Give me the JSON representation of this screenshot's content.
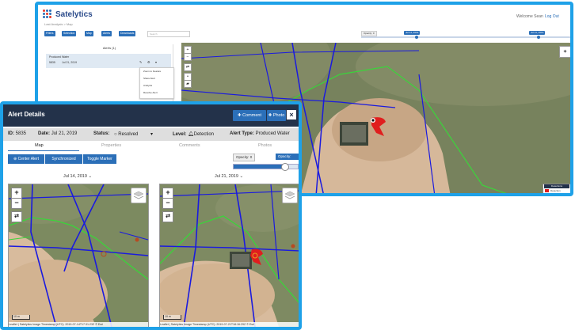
{
  "app": {
    "name": "Satelytics",
    "welcome": "Welcome Sean",
    "logout": "Log Out",
    "breadcrumb": "Last Analysis  >  Map"
  },
  "toolbar": {
    "buttons": [
      "Filters",
      "Selection",
      "Map",
      "Alerts",
      "Downloads"
    ],
    "search_placeholder": "Search",
    "opacity_label": "Opacity: 0",
    "date_a": "Jul 14, 2019",
    "date_b": "Jul 21, 2019"
  },
  "alerts_panel": {
    "title": "Alerts (1)",
    "alert_type": "Produced Water",
    "alert_id": "5835",
    "alert_date": "Jul 21, 2019",
    "menu": [
      "Zoom to Feature",
      "Share Alert",
      "Analysis",
      "Resolve Alert"
    ]
  },
  "legend": {
    "title": "Detections",
    "item": "Detection",
    "color": "#e01e1e"
  },
  "dialog": {
    "title": "Alert Details",
    "comment_button": "Comment",
    "photo_button": "Photo",
    "close": "×",
    "info": {
      "id_label": "ID:",
      "id": "5835",
      "date_label": "Date:",
      "date": "Jul 21, 2019",
      "status_label": "Status:",
      "status": "Resolved",
      "level_label": "Level:",
      "level": "Detection",
      "type_label": "Alert Type:",
      "type": "Produced Water"
    },
    "tabs": [
      "Map",
      "Properties",
      "Comments",
      "Photos"
    ],
    "map_buttons": [
      "Center Alert",
      "Synchronized",
      "Toggle Marker"
    ],
    "opacity_left": "Opacity: 0",
    "opacity_right": "Opacity: 0.4",
    "opacity_value": 0.8,
    "left_map": {
      "date": "Jul 14, 2019",
      "scale": "10 m",
      "attribution": "Leaflet | Satelytics Image Timestamp (UTC): 2019-07-14T17:31:23Z  © Esri"
    },
    "right_map": {
      "date": "Jul 21, 2019",
      "scale": "10 m",
      "attribution": "Leaflet | Satelytics Image Timestamp (UTC): 2019-07-21T18:16:29Z  © Esri"
    }
  },
  "colors": {
    "accent": "#1ea1e8",
    "header": "#23324a",
    "button": "#2b6fb8",
    "alert_red": "#e01e1e",
    "pipeline_blue": "#1a1adf",
    "boundary_green": "#3bd43b"
  }
}
